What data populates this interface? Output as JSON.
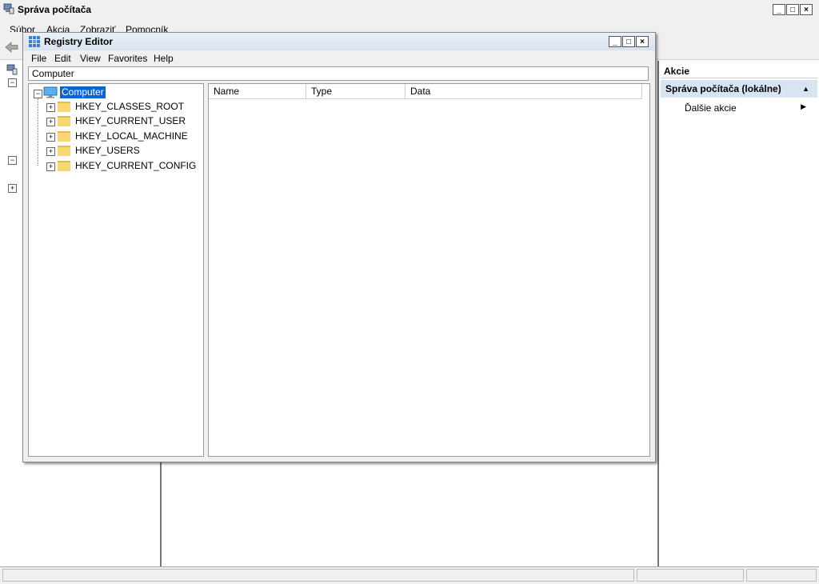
{
  "outer_window": {
    "title": "Správa počítača",
    "menu": [
      "Súbor",
      "Akcia",
      "Zobraziť",
      "Pomocník"
    ],
    "minimize": "_",
    "maximize": "□",
    "close": "×"
  },
  "actions_pane": {
    "header": "Akcie",
    "group_title": "Správa počítača (lokálne)",
    "more_actions": "Ďalšie akcie"
  },
  "registry_editor": {
    "title": "Registry Editor",
    "menu": [
      "File",
      "Edit",
      "View",
      "Favorites",
      "Help"
    ],
    "address": "Computer",
    "tree": {
      "root": "Computer",
      "hives": [
        "HKEY_CLASSES_ROOT",
        "HKEY_CURRENT_USER",
        "HKEY_LOCAL_MACHINE",
        "HKEY_USERS",
        "HKEY_CURRENT_CONFIG"
      ]
    },
    "columns": [
      "Name",
      "Type",
      "Data"
    ],
    "minimize": "_",
    "maximize": "□",
    "close": "×"
  },
  "colors": {
    "selection": "#0a64d2",
    "actions_group_bg": "#d9e4f2",
    "folder": "#f8d775"
  }
}
